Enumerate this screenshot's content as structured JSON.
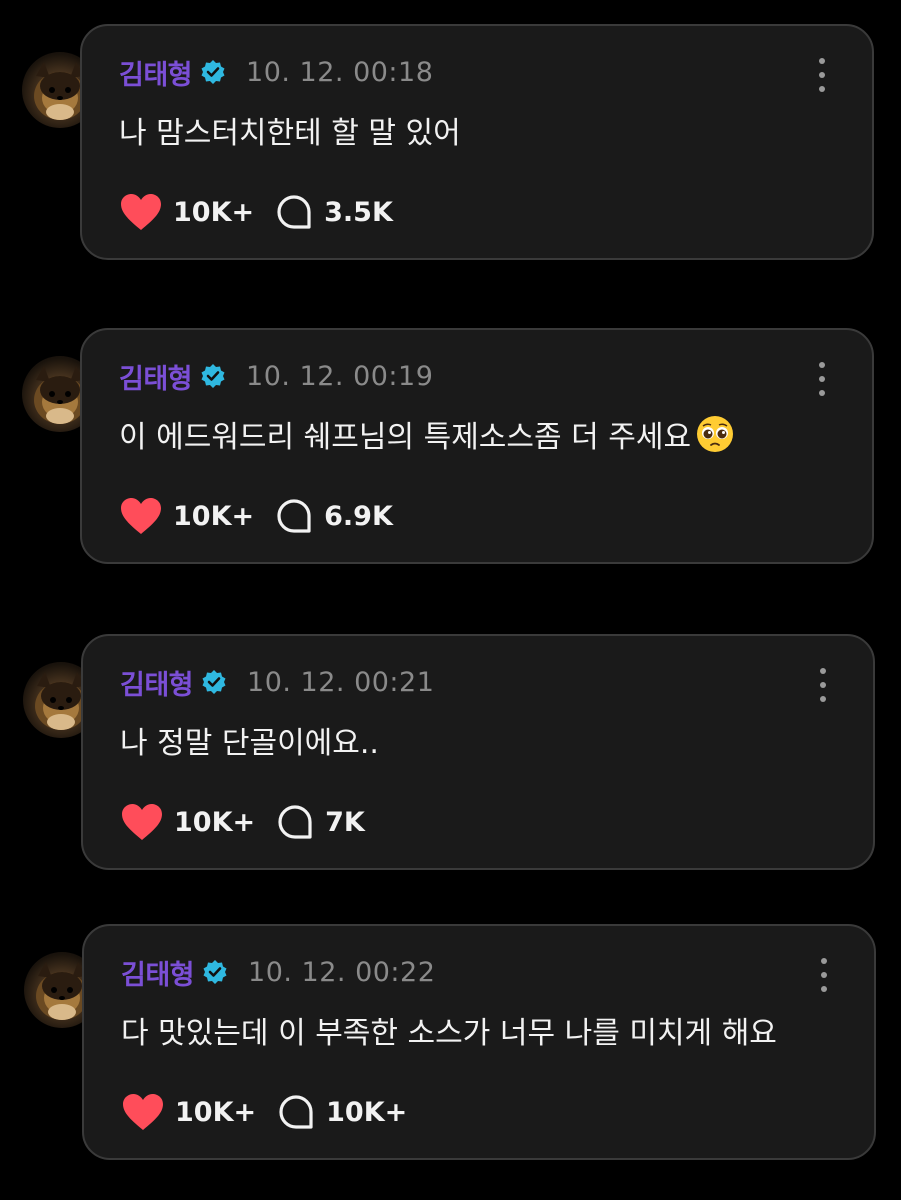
{
  "colors": {
    "background": "#000000",
    "card": "#1a1a1a",
    "card_border": "#3a3a3a",
    "name": "#7b4fd6",
    "verified": "#2fb8e0",
    "timestamp": "#8a8a8a",
    "heart": "#ff4d5a",
    "text": "#f2f2f2"
  },
  "posts": [
    {
      "author": "김태형",
      "verified_icon": "verified-badge-icon",
      "timestamp": "10. 12. 00:18",
      "text": "나 맘스터치한테 할 말 있어",
      "emoji": "",
      "likes": "10K+",
      "replies": "3.5K"
    },
    {
      "author": "김태형",
      "verified_icon": "verified-badge-icon",
      "timestamp": "10. 12. 00:19",
      "text": "이 에드워드리 쉐프님의 특제소스좀 더 주세요",
      "emoji": "pleading-face-emoji",
      "likes": "10K+",
      "replies": "6.9K"
    },
    {
      "author": "김태형",
      "verified_icon": "verified-badge-icon",
      "timestamp": "10. 12. 00:21",
      "text": "나 정말 단골이에요..",
      "emoji": "",
      "likes": "10K+",
      "replies": "7K"
    },
    {
      "author": "김태형",
      "verified_icon": "verified-badge-icon",
      "timestamp": "10. 12. 00:22",
      "text": "다 맛있는데 이 부족한 소스가 너무 나를 미치게 해요",
      "emoji": "",
      "likes": "10K+",
      "replies": "10K+"
    }
  ]
}
